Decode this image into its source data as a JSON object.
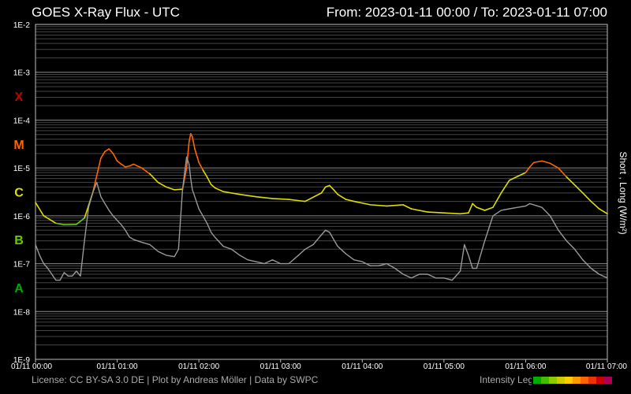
{
  "header": {
    "title": "GOES X-Ray Flux - UTC",
    "range": "From: 2023-01-11 00:00  /  To: 2023-01-11 07:00"
  },
  "footer": {
    "credits": "License: CC BY-SA 3.0 DE | Plot by Andreas Möller | Data by SWPC",
    "legend_label": "Intensity Legend",
    "legend_colors": [
      "#00aa00",
      "#44bb00",
      "#88cc00",
      "#cccc00",
      "#ffcc00",
      "#ff9900",
      "#ff6600",
      "#ee3300",
      "#cc0000",
      "#aa0055"
    ]
  },
  "colors": {
    "background": "#000000",
    "grid": "#444444",
    "short_series": "#999999",
    "class_X": "#cc0000",
    "class_M": "#ff6600",
    "class_C": "#dddd00",
    "class_B": "#66cc00",
    "class_A": "#00aa00"
  },
  "chart_data": {
    "type": "line",
    "title": "GOES X-Ray Flux - UTC",
    "ylabel": "Short , Long (W/m²)",
    "y_scale": "log",
    "ylim": [
      1e-09,
      0.01
    ],
    "xlim": [
      "01/11 00:00",
      "01/11 07:00"
    ],
    "x_ticks": [
      "01/11 00:00",
      "01/11 01:00",
      "01/11 02:00",
      "01/11 03:00",
      "01/11 04:00",
      "01/11 05:00",
      "01/11 06:00",
      "01/11 07:00"
    ],
    "y_ticks": [
      "1E-2",
      "1E-3",
      "1E-4",
      "1E-5",
      "1E-6",
      "1E-7",
      "1E-8",
      "1E-9"
    ],
    "flare_classes": [
      {
        "label": "X",
        "decade": -3.5
      },
      {
        "label": "M",
        "decade": -4.5
      },
      {
        "label": "C",
        "decade": -5.5
      },
      {
        "label": "B",
        "decade": -6.5
      },
      {
        "label": "A",
        "decade": -7.5
      }
    ],
    "grid": true,
    "series": [
      {
        "name": "Long",
        "color_by_intensity": true,
        "x_hours": [
          0,
          0.1,
          0.25,
          0.35,
          0.5,
          0.6,
          0.7,
          0.8,
          0.85,
          0.9,
          0.95,
          1.0,
          1.05,
          1.1,
          1.15,
          1.2,
          1.3,
          1.4,
          1.5,
          1.6,
          1.7,
          1.8,
          1.85,
          1.88,
          1.9,
          1.92,
          1.95,
          2.0,
          2.05,
          2.1,
          2.15,
          2.2,
          2.3,
          2.5,
          2.7,
          2.9,
          3.1,
          3.3,
          3.5,
          3.55,
          3.6,
          3.65,
          3.7,
          3.8,
          3.9,
          4.1,
          4.3,
          4.5,
          4.6,
          4.8,
          5.0,
          5.2,
          5.3,
          5.35,
          5.4,
          5.5,
          5.6,
          5.7,
          5.8,
          6.0,
          6.05,
          6.1,
          6.2,
          6.3,
          6.4,
          6.5,
          6.7,
          6.8,
          6.9,
          7.0
        ],
        "values": [
          1.9e-06,
          1e-06,
          7e-07,
          6.5e-07,
          6.6e-07,
          9e-07,
          3e-06,
          1.6e-05,
          2.2e-05,
          2.5e-05,
          2e-05,
          1.4e-05,
          1.2e-05,
          1.05e-05,
          1.1e-05,
          1.2e-05,
          1e-05,
          7.5e-06,
          5e-06,
          4e-06,
          3.5e-06,
          3.6e-06,
          1e-05,
          3.5e-05,
          5.2e-05,
          4.5e-05,
          2.5e-05,
          1.3e-05,
          9e-06,
          6.5e-06,
          4.5e-06,
          3.8e-06,
          3.2e-06,
          2.8e-06,
          2.5e-06,
          2.3e-06,
          2.2e-06,
          2e-06,
          3e-06,
          4e-06,
          4.3e-06,
          3.5e-06,
          2.8e-06,
          2.2e-06,
          2e-06,
          1.7e-06,
          1.6e-06,
          1.7e-06,
          1.4e-06,
          1.2e-06,
          1.15e-06,
          1.1e-06,
          1.15e-06,
          1.8e-06,
          1.5e-06,
          1.3e-06,
          1.5e-06,
          3e-06,
          5.5e-06,
          8e-06,
          1.05e-05,
          1.3e-05,
          1.4e-05,
          1.25e-05,
          1e-05,
          6.5e-06,
          3e-06,
          2e-06,
          1.4e-06,
          1.1e-06
        ]
      },
      {
        "name": "Short",
        "color": "#999999",
        "x_hours": [
          0,
          0.05,
          0.1,
          0.15,
          0.2,
          0.25,
          0.3,
          0.35,
          0.4,
          0.45,
          0.5,
          0.55,
          0.6,
          0.65,
          0.7,
          0.75,
          0.8,
          0.85,
          0.9,
          0.95,
          1.0,
          1.05,
          1.1,
          1.15,
          1.2,
          1.3,
          1.4,
          1.5,
          1.6,
          1.7,
          1.75,
          1.8,
          1.85,
          1.88,
          1.9,
          1.92,
          1.95,
          2.0,
          2.1,
          2.15,
          2.2,
          2.3,
          2.4,
          2.5,
          2.6,
          2.7,
          2.8,
          2.9,
          3.0,
          3.1,
          3.2,
          3.3,
          3.4,
          3.5,
          3.55,
          3.6,
          3.65,
          3.7,
          3.8,
          3.9,
          4.0,
          4.1,
          4.2,
          4.3,
          4.4,
          4.5,
          4.6,
          4.7,
          4.8,
          4.9,
          5.0,
          5.1,
          5.2,
          5.25,
          5.3,
          5.35,
          5.4,
          5.5,
          5.6,
          5.7,
          5.8,
          5.9,
          6.0,
          6.05,
          6.1,
          6.2,
          6.3,
          6.4,
          6.5,
          6.6,
          6.7,
          6.8,
          6.9,
          7.0
        ],
        "values": [
          2.5e-07,
          1.5e-07,
          1e-07,
          8e-08,
          6e-08,
          4.5e-08,
          4.5e-08,
          6.5e-08,
          5.5e-08,
          5.5e-08,
          7e-08,
          5.5e-08,
          3e-07,
          1.5e-06,
          3e-06,
          5e-06,
          2.5e-06,
          1.8e-06,
          1.3e-06,
          1e-06,
          8e-07,
          6.5e-07,
          5e-07,
          3.6e-07,
          3.2e-07,
          2.8e-07,
          2.5e-07,
          1.8e-07,
          1.5e-07,
          1.4e-07,
          2e-07,
          3.5e-06,
          1.7e-05,
          1.2e-05,
          6e-06,
          3.5e-06,
          2.5e-06,
          1.4e-06,
          7e-07,
          4.5e-07,
          3.5e-07,
          2.3e-07,
          2e-07,
          1.5e-07,
          1.2e-07,
          1.1e-07,
          1e-07,
          1.2e-07,
          1e-07,
          1e-07,
          1.4e-07,
          2e-07,
          2.5e-07,
          4e-07,
          5e-07,
          4.5e-07,
          3.2e-07,
          2.3e-07,
          1.6e-07,
          1.2e-07,
          1.1e-07,
          9e-08,
          9e-08,
          1e-07,
          8e-08,
          6e-08,
          5e-08,
          6e-08,
          6e-08,
          5e-08,
          5e-08,
          4.5e-08,
          7e-08,
          2.5e-07,
          1.5e-07,
          8e-08,
          8e-08,
          3e-07,
          1e-06,
          1.3e-06,
          1.4e-06,
          1.5e-06,
          1.6e-06,
          1.8e-06,
          1.7e-06,
          1.5e-06,
          1e-06,
          5e-07,
          3e-07,
          2e-07,
          1.2e-07,
          8e-08,
          6e-08,
          5e-08
        ]
      }
    ]
  }
}
